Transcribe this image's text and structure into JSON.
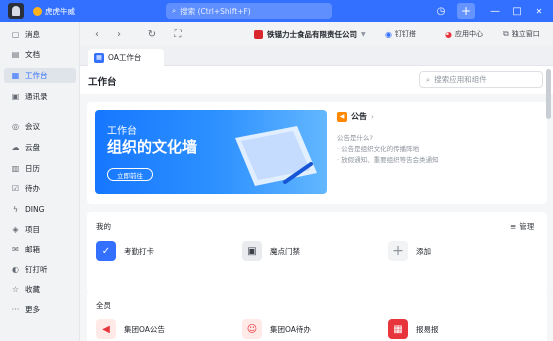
{
  "titlebar": {
    "store": "虎虎牛威",
    "search_placeholder": "搜索 (Ctrl+Shift+F)",
    "history_icon": "history-icon",
    "plus_icon": "plus-icon",
    "minimize": "—",
    "maximize": "□",
    "close": "✕"
  },
  "sidebar": {
    "items": [
      {
        "label": "消息",
        "icon": "message-icon"
      },
      {
        "label": "文档",
        "icon": "document-icon"
      },
      {
        "label": "工作台",
        "icon": "workbench-icon",
        "active": true
      },
      {
        "label": "通讯录",
        "icon": "contacts-icon"
      },
      {
        "label": "会议",
        "icon": "meeting-icon"
      },
      {
        "label": "云盘",
        "icon": "cloud-icon"
      },
      {
        "label": "日历",
        "icon": "calendar-icon"
      },
      {
        "label": "待办",
        "icon": "todo-icon"
      },
      {
        "label": "DING",
        "icon": "ding-icon"
      },
      {
        "label": "项目",
        "icon": "project-icon"
      },
      {
        "label": "邮箱",
        "icon": "mail-icon"
      },
      {
        "label": "钉打听",
        "icon": "ding-listen-icon"
      },
      {
        "label": "收藏",
        "icon": "star-icon"
      },
      {
        "label": "更多",
        "icon": "more-icon"
      }
    ]
  },
  "toolbar": {
    "company": "铁锚力士食品有限责任公司",
    "links": [
      {
        "label": "钉钉搭",
        "icon": "ding-build-icon"
      },
      {
        "label": "应用中心",
        "icon": "app-center-icon"
      },
      {
        "label": "独立窗口",
        "icon": "window-icon"
      }
    ]
  },
  "tab": {
    "label": "OA工作台"
  },
  "content": {
    "title": "工作台",
    "search_placeholder": "搜索应用和组件",
    "banner": {
      "line1": "工作台",
      "line2": "组织的文化墙",
      "button": "立即前往"
    },
    "notice": {
      "title": "公告",
      "lines": [
        "公告是什么?",
        "· 公告是组织文化的传播阵地",
        "· 放假通知、重要组织等告会类通知"
      ]
    },
    "mine": {
      "label": "我的",
      "manage": "管理",
      "apps": [
        {
          "label": "考勤打卡",
          "icon": "attendance-icon",
          "color": "#3370ff"
        },
        {
          "label": "魔点门禁",
          "icon": "door-access-icon",
          "color": "#e9ebef"
        },
        {
          "label": "添加",
          "icon": "add-icon",
          "color": "#f2f3f5"
        }
      ]
    },
    "all": {
      "label": "全员",
      "apps": [
        {
          "label": "集团OA公告",
          "icon": "announcement-icon",
          "color": "#ffeae8"
        },
        {
          "label": "集团OA待办",
          "icon": "todo-user-icon",
          "color": "#ffeae8"
        },
        {
          "label": "报易报",
          "icon": "report-icon",
          "color": "#e8343c"
        }
      ]
    }
  }
}
